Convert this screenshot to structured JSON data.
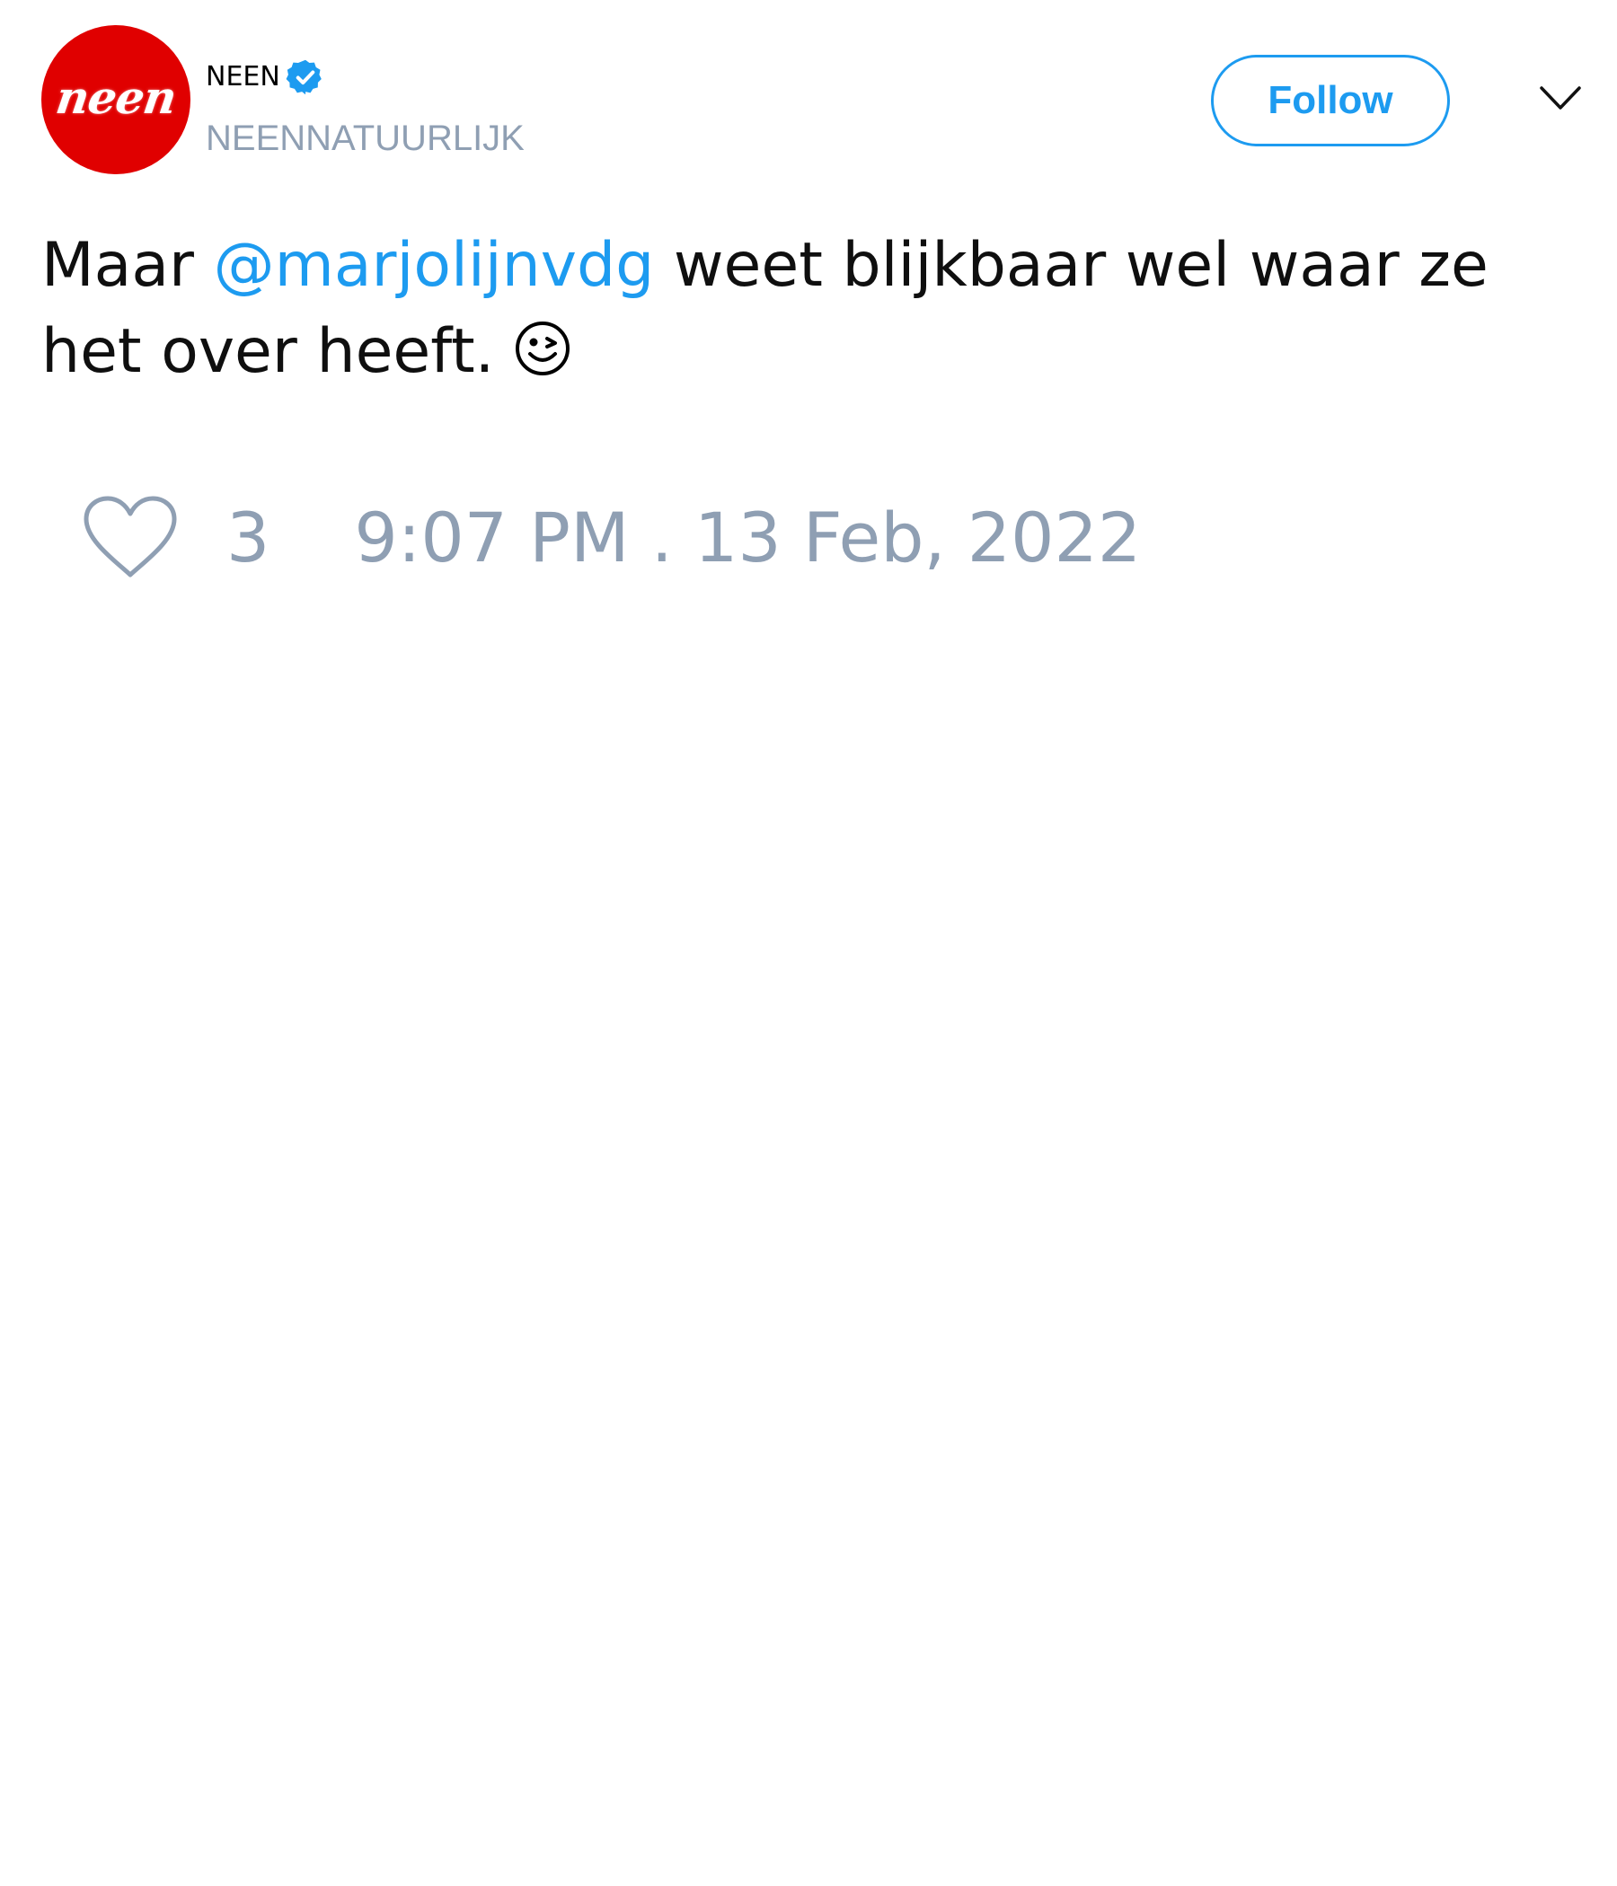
{
  "author": {
    "display_name": "NEEN",
    "handle": "NEENNATUURLIJK",
    "avatar_text": "neen",
    "verified": true,
    "avatar_color": "#e00000"
  },
  "actions": {
    "follow_label": "Follow",
    "menu_icon": "chevron-down-icon"
  },
  "tweet": {
    "text_before": "Maar ",
    "mention": "@marjolijnvdg",
    "text_after": " weet blijkbaar wel waar ze het over heeft. ",
    "emoji": "winking-face-icon"
  },
  "footer": {
    "like_icon": "heart-icon",
    "like_count": "3",
    "timestamp": "9:07 PM . 13 Feb, 2022"
  },
  "colors": {
    "accent": "#1d9bf0",
    "muted": "#8f9fb3",
    "text": "#0f0f0f"
  }
}
